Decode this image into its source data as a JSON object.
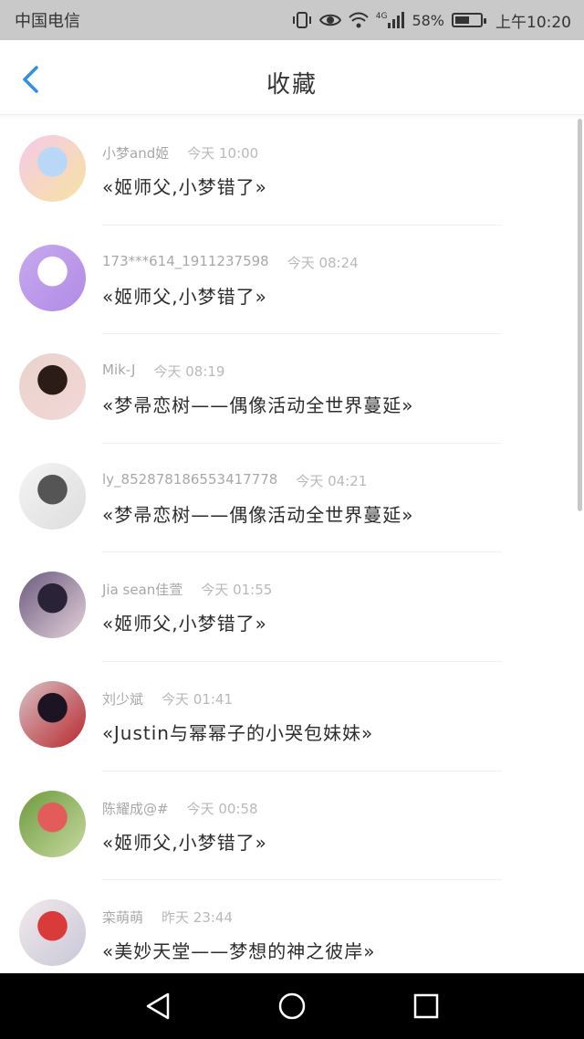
{
  "status_bar": {
    "carrier": "中国电信",
    "network": "4G",
    "battery": "58%",
    "battery_level": 0.58,
    "time": "上午10:20"
  },
  "header": {
    "title": "收藏",
    "back_icon": "chevron-left-icon",
    "accent_color": "#2f8fe6"
  },
  "favorites": [
    {
      "user": "小梦and姬",
      "time": "今天 10:00",
      "message": "«姬师父,小梦错了»",
      "avatar_colors": [
        "#f5c9e8",
        "#b9d7f7",
        "#f7e3a1"
      ]
    },
    {
      "user": "173***614_1911237598",
      "time": "今天 08:24",
      "message": "«姬师父,小梦错了»",
      "avatar_colors": [
        "#c6a9ef",
        "#ffffff",
        "#b28be6"
      ]
    },
    {
      "user": "Mik-J",
      "time": "今天 08:19",
      "message": "«梦帚恋树——偶像活动全世界蔓延»",
      "avatar_colors": [
        "#e9d4cc",
        "#2b1c18",
        "#f2d6d6"
      ]
    },
    {
      "user": "ly_852878186553417778",
      "time": "今天 04:21",
      "message": "«梦帚恋树——偶像活动全世界蔓延»",
      "avatar_colors": [
        "#f4f4f4",
        "#555555",
        "#dddddd"
      ]
    },
    {
      "user": "Jia sean佳萱",
      "time": "今天 01:55",
      "message": "«姬师父,小梦错了»",
      "avatar_colors": [
        "#6b5a80",
        "#2a2236",
        "#e4d1d9"
      ]
    },
    {
      "user": "刘少斌",
      "time": "今天 01:41",
      "message": "«Justin与幂幂子的小哭包妹妹»",
      "avatar_colors": [
        "#d8c2c6",
        "#1c1422",
        "#b8282e"
      ]
    },
    {
      "user": "陈耀成@#",
      "time": "今天 00:58",
      "message": "«姬师父,小梦错了»",
      "avatar_colors": [
        "#6d9b3d",
        "#e35c5c",
        "#c7d9a0"
      ]
    },
    {
      "user": "栾萌萌",
      "time": "昨天 23:44",
      "message": "«美妙天堂——梦想的神之彼岸»",
      "avatar_colors": [
        "#f2e8ea",
        "#d93a3a",
        "#c8c8d8"
      ]
    }
  ],
  "nav_bar": {
    "back": "triangle-back-icon",
    "home": "circle-home-icon",
    "recents": "square-recents-icon"
  }
}
